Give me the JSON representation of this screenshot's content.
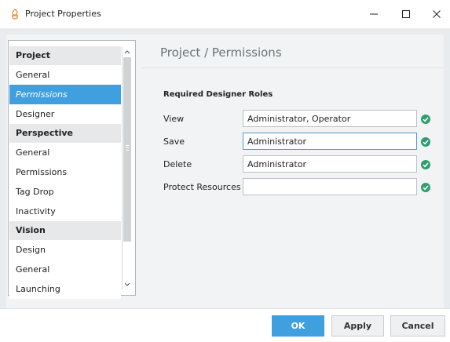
{
  "window": {
    "title": "Project Properties",
    "controls": [
      "minimize",
      "maximize",
      "close"
    ]
  },
  "nav": {
    "groups": [
      {
        "heading": "Project",
        "items": [
          "General",
          "Permissions",
          "Designer"
        ]
      },
      {
        "heading": "Perspective",
        "items": [
          "General",
          "Permissions",
          "Tag Drop",
          "Inactivity"
        ]
      },
      {
        "heading": "Vision",
        "items": [
          "Design",
          "General",
          "Launching"
        ]
      }
    ],
    "selected": "Project / Permissions"
  },
  "content": {
    "title": "Project / Permissions",
    "section_heading": "Required Designer Roles",
    "rows": [
      {
        "label": "View",
        "value": "Administrator, Operator",
        "valid": true
      },
      {
        "label": "Save",
        "value": "Administrator",
        "valid": true,
        "focused": true
      },
      {
        "label": "Delete",
        "value": "Administrator",
        "valid": true
      },
      {
        "label": "Protect Resources",
        "value": "",
        "valid": true
      }
    ]
  },
  "footer": {
    "ok_label": "OK",
    "apply_label": "Apply",
    "cancel_label": "Cancel"
  },
  "colors": {
    "accent": "#3f9fdf",
    "valid_check": "#2e9e6e",
    "logo": "#e8862a"
  },
  "icons": {
    "app": "ignition-logo-icon",
    "valid": "check-circle-icon"
  }
}
